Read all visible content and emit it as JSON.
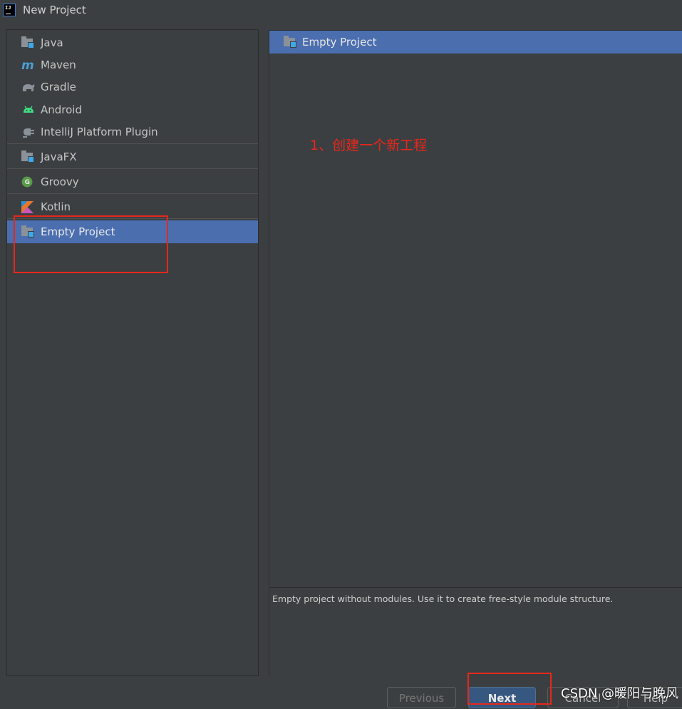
{
  "window": {
    "title": "New Project"
  },
  "project_types": [
    {
      "label": "Java",
      "icon": "java-folder-icon"
    },
    {
      "label": "Maven",
      "icon": "maven-icon"
    },
    {
      "label": "Gradle",
      "icon": "gradle-icon"
    },
    {
      "label": "Android",
      "icon": "android-icon"
    },
    {
      "label": "IntelliJ Platform Plugin",
      "icon": "plugin-icon"
    },
    {
      "label": "JavaFX",
      "icon": "javafx-folder-icon"
    },
    {
      "label": "Groovy",
      "icon": "groovy-icon"
    },
    {
      "label": "Kotlin",
      "icon": "kotlin-icon"
    },
    {
      "label": "Empty Project",
      "icon": "empty-project-folder-icon",
      "selected": true
    }
  ],
  "template_list": {
    "items": [
      {
        "label": "Empty Project"
      }
    ]
  },
  "annotation": "1、创建一个新工程",
  "description": "Empty project without modules. Use it to create free-style module structure.",
  "buttons": {
    "previous": "Previous",
    "next": "Next",
    "cancel": "Cancel",
    "help": "Help"
  },
  "watermark": "CSDN @暖阳与晚风",
  "colors": {
    "background": "#3c3f41",
    "selection": "#4b6eaf",
    "annotation_red": "#e8271b",
    "next_button": "#365880"
  }
}
